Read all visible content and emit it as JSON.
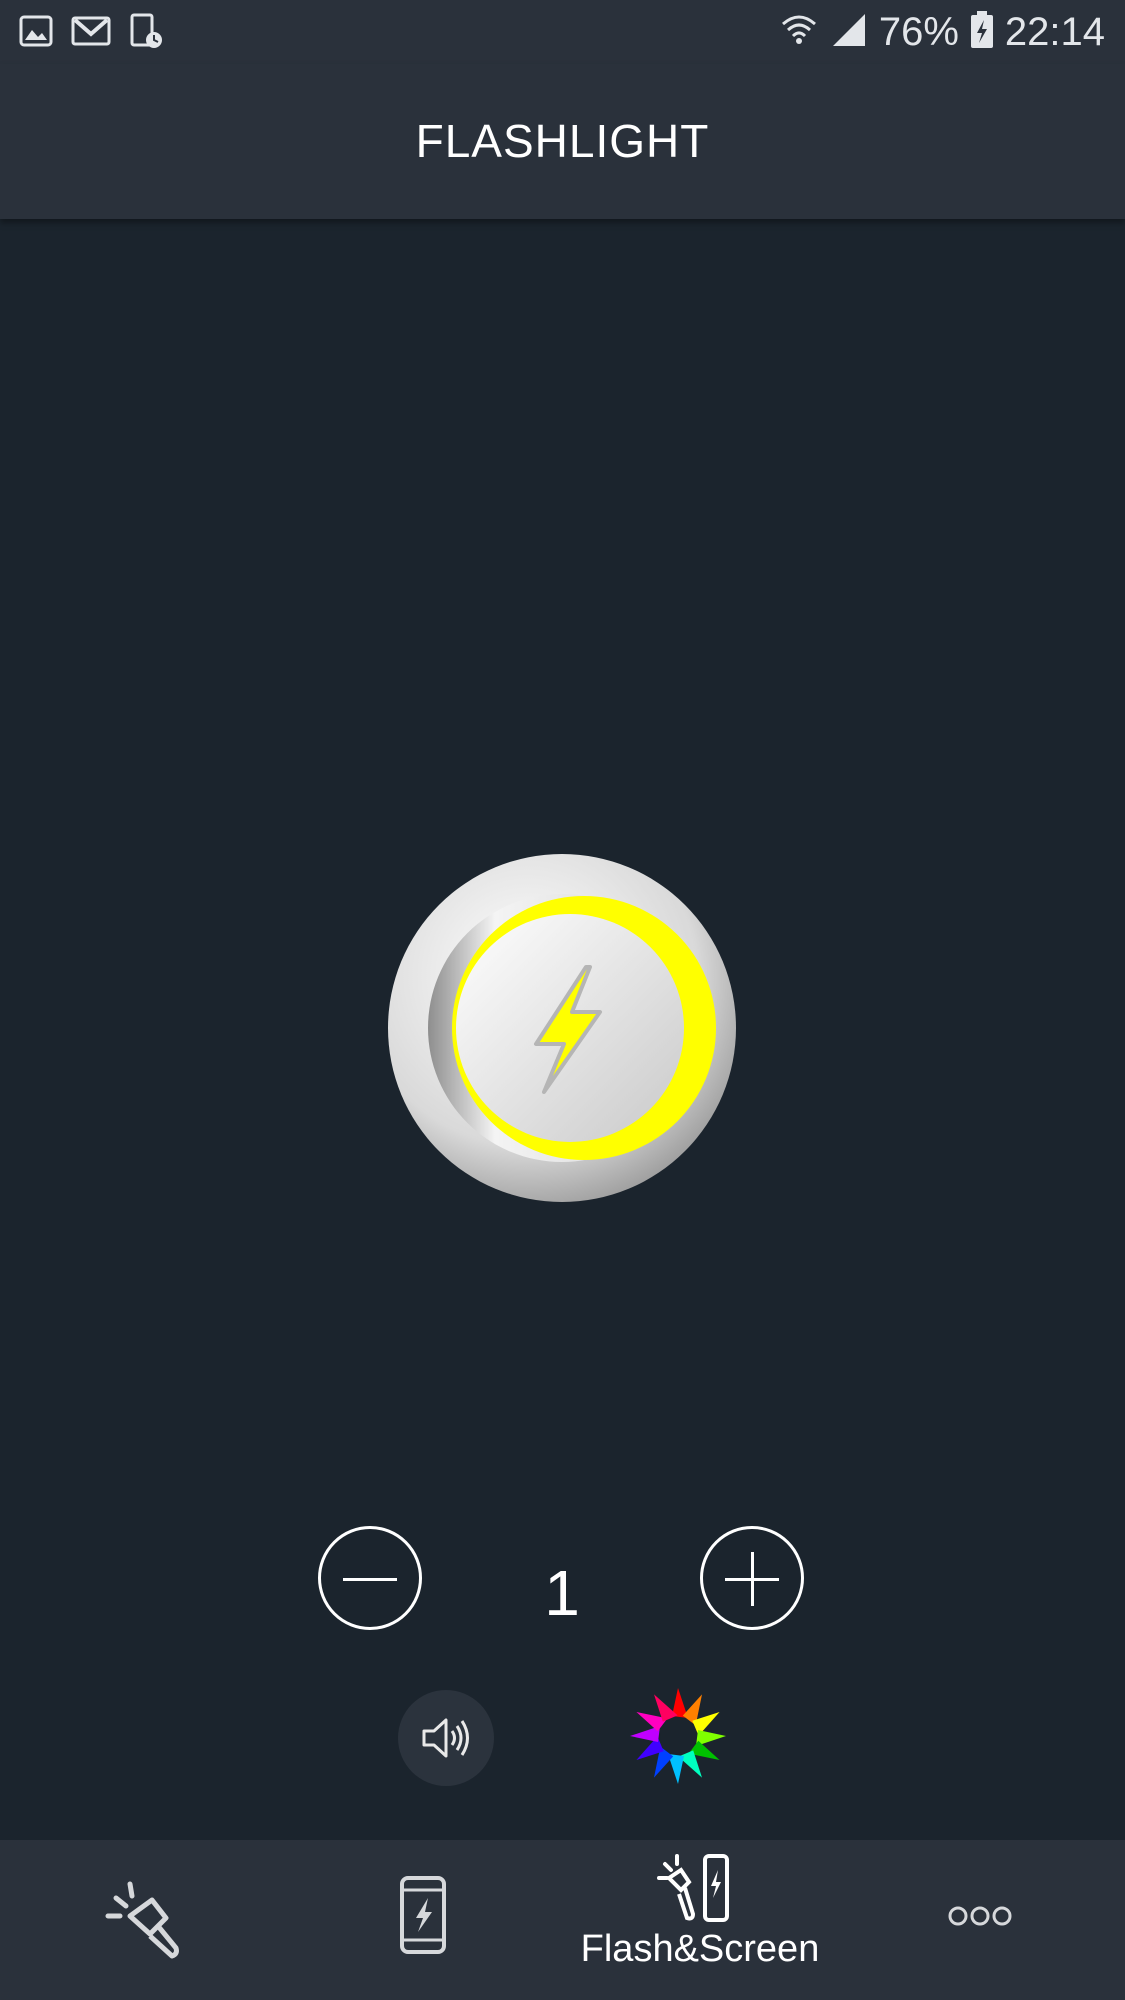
{
  "status_bar": {
    "battery": "76%",
    "time": "22:14",
    "left_icons": [
      "gallery-icon",
      "gmail-icon",
      "device-schedule-icon"
    ],
    "right_icons": [
      "wifi-icon",
      "signal-icon",
      "battery-charging-icon"
    ]
  },
  "app_bar": {
    "title": "FLASHLIGHT"
  },
  "power_button": {
    "icon": "lightning-bolt-icon",
    "accent_color": "#ffff00"
  },
  "intensity": {
    "value": "1",
    "decrease_icon": "minus-icon",
    "increase_icon": "plus-icon"
  },
  "controls": {
    "sound_icon": "speaker-icon",
    "color_icon": "color-wheel-icon"
  },
  "bottom_nav": {
    "items": [
      {
        "icon": "flashlight-icon",
        "label": ""
      },
      {
        "icon": "phone-screen-icon",
        "label": ""
      },
      {
        "icon": "flash-and-screen-icon",
        "label": "Flash&Screen",
        "active": true
      },
      {
        "icon": "more-icon",
        "label": ""
      }
    ]
  },
  "colors": {
    "background": "#1b242d",
    "bar": "#2a313b",
    "accent": "#ffff00"
  }
}
